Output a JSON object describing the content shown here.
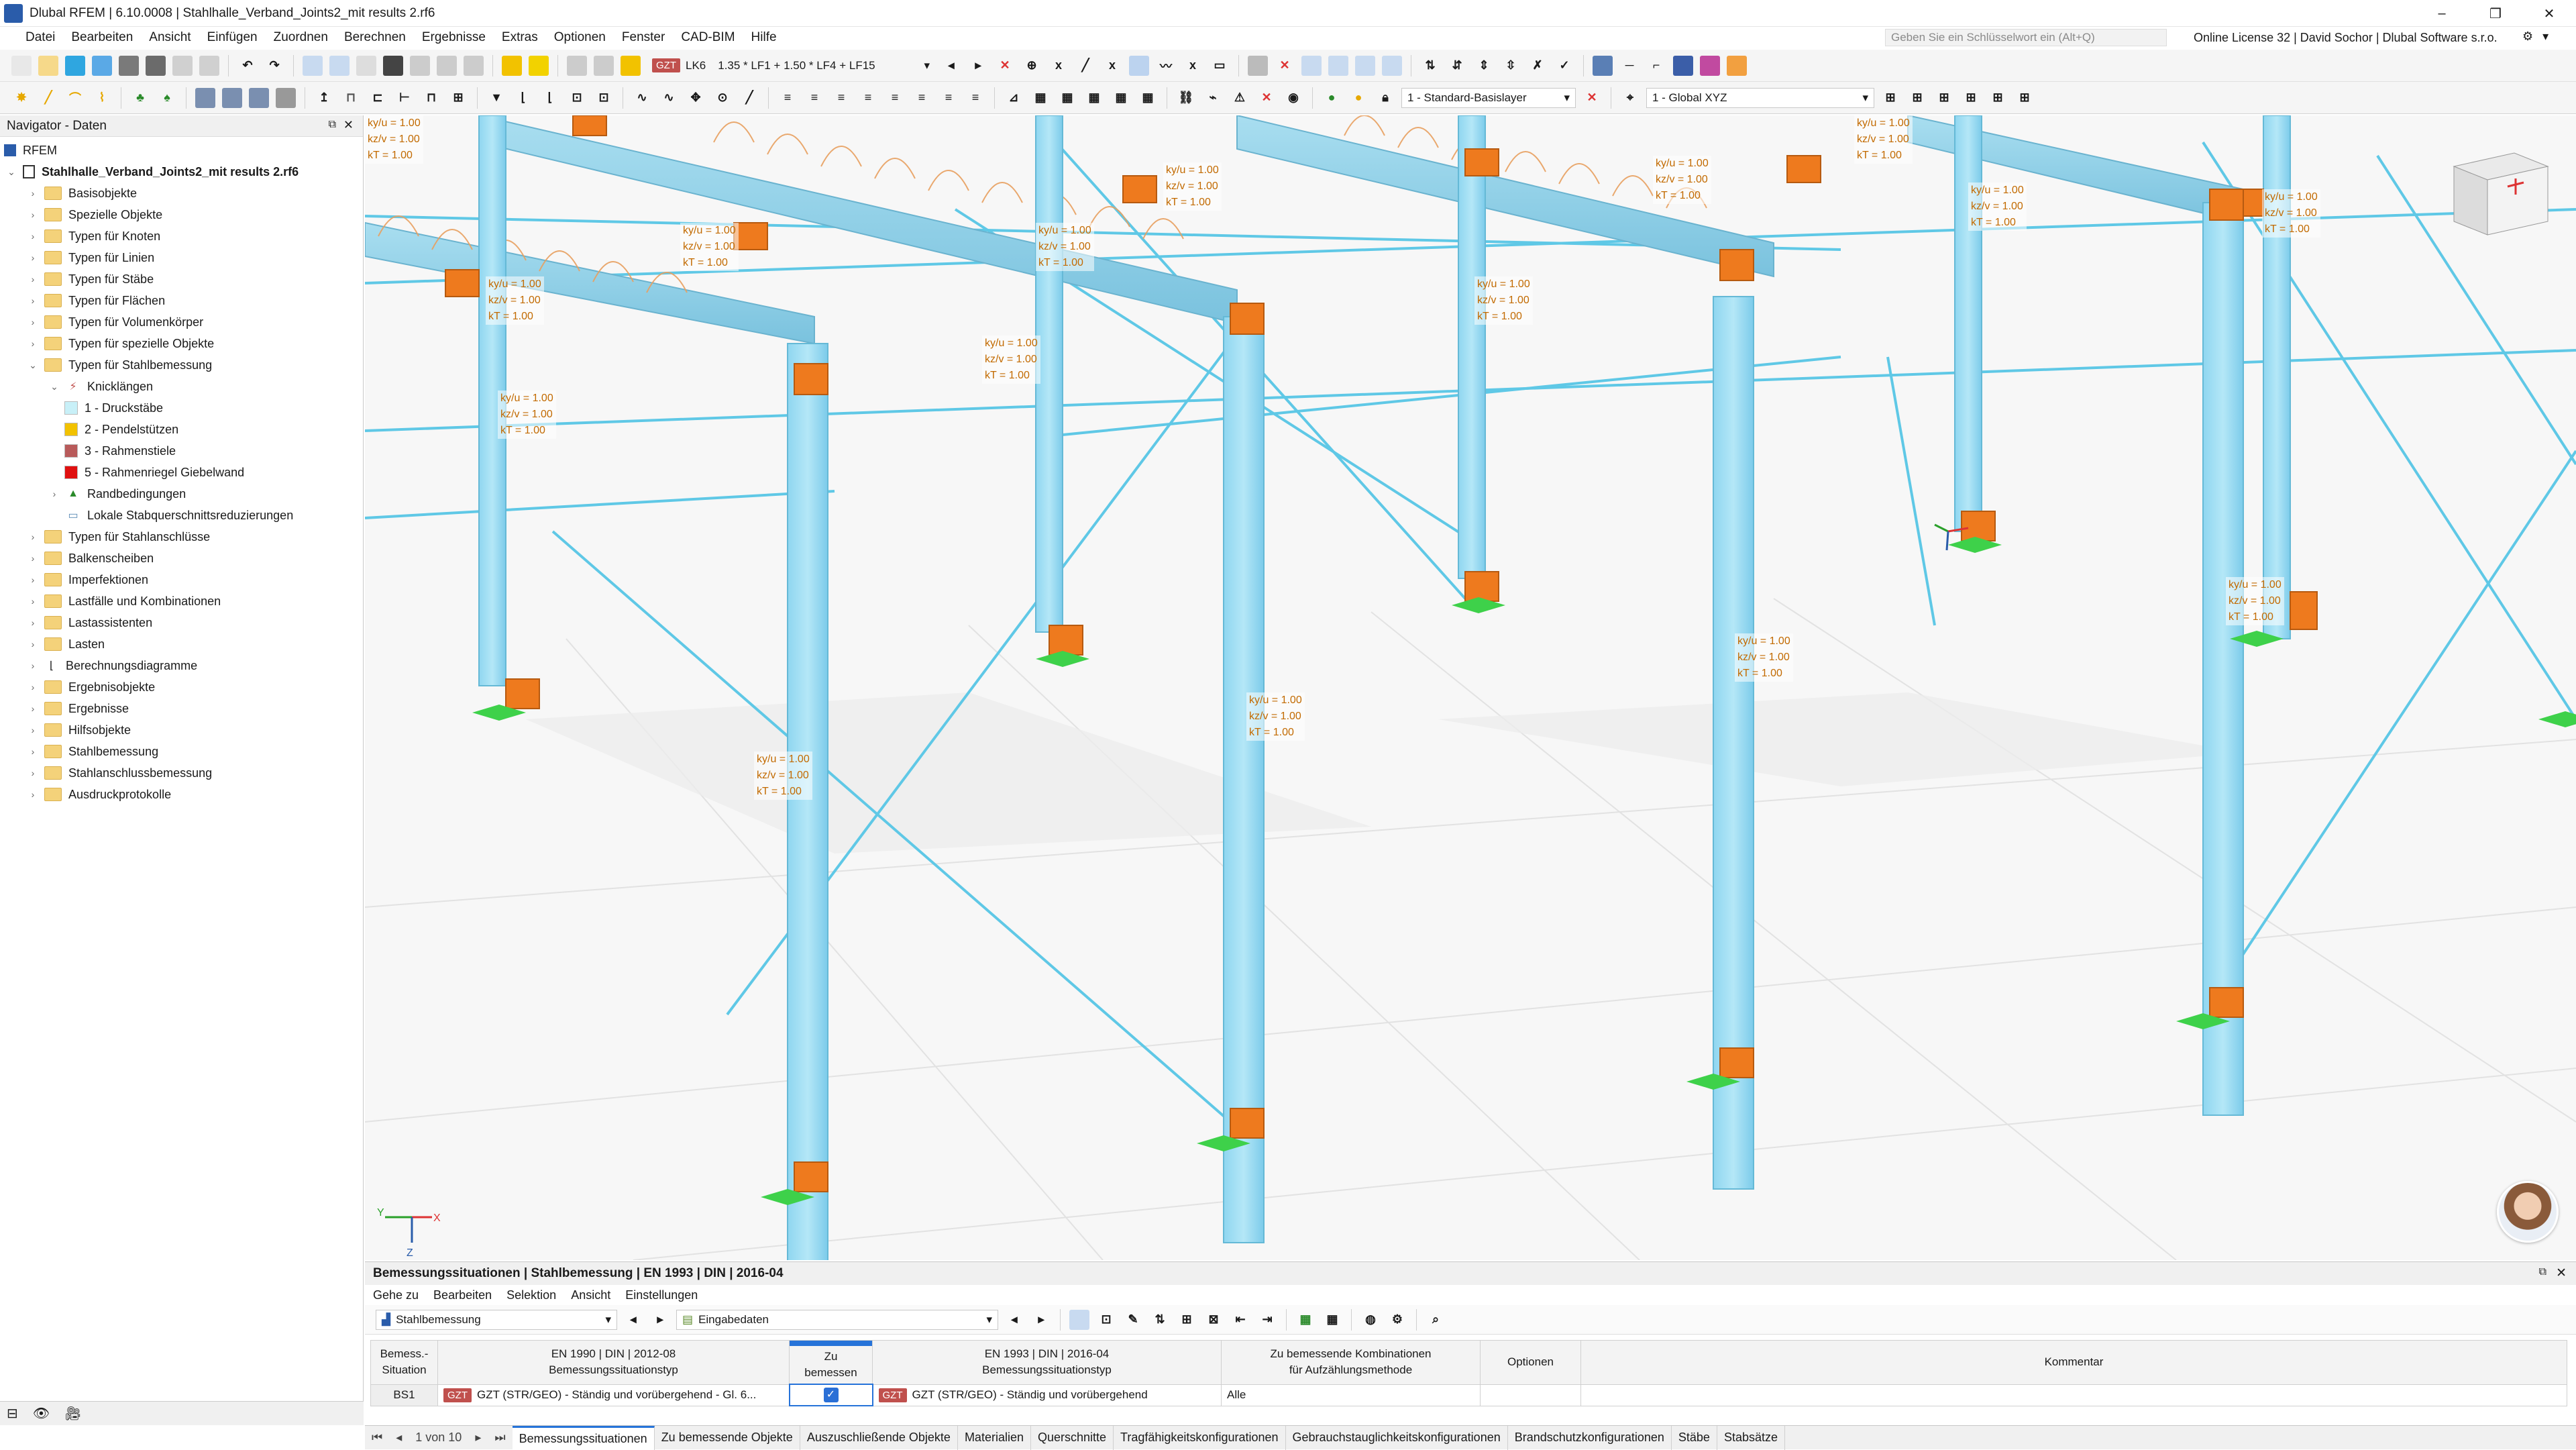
{
  "window": {
    "title": "Dlubal RFEM | 6.10.0008 | Stahlhalle_Verband_Joints2_mit results 2.rf6",
    "minimize": "–",
    "restore": "❐",
    "close": "✕"
  },
  "menu": [
    "Datei",
    "Bearbeiten",
    "Ansicht",
    "Einfügen",
    "Zuordnen",
    "Berechnen",
    "Ergebnisse",
    "Extras",
    "Optionen",
    "Fenster",
    "CAD-BIM",
    "Hilfe"
  ],
  "search": {
    "placeholder": "Geben Sie ein Schlüsselwort ein (Alt+Q)"
  },
  "license": "Online License 32 | David Sochor | Dlubal Software s.r.o.",
  "toolbar": {
    "load_badge": "GZT",
    "load_case": "LK6",
    "combination": "1.35 * LF1 + 1.50 * LF4 + LF15",
    "layer": "1 - Standard-Basislayer",
    "coord_system": "1 - Global XYZ"
  },
  "navigator": {
    "title": "Navigator - Daten",
    "root": "RFEM",
    "file": "Stahlhalle_Verband_Joints2_mit results 2.rf6",
    "items": [
      {
        "label": "Basisobjekte",
        "level": 1,
        "type": "folder"
      },
      {
        "label": "Spezielle Objekte",
        "level": 1,
        "type": "folder"
      },
      {
        "label": "Typen für Knoten",
        "level": 1,
        "type": "folder"
      },
      {
        "label": "Typen für Linien",
        "level": 1,
        "type": "folder"
      },
      {
        "label": "Typen für Stäbe",
        "level": 1,
        "type": "folder"
      },
      {
        "label": "Typen für Flächen",
        "level": 1,
        "type": "folder"
      },
      {
        "label": "Typen für Volumenkörper",
        "level": 1,
        "type": "folder"
      },
      {
        "label": "Typen für spezielle Objekte",
        "level": 1,
        "type": "folder"
      },
      {
        "label": "Typen für Stahlbemessung",
        "level": 1,
        "type": "folder",
        "expanded": true
      },
      {
        "label": "Knicklängen",
        "level": 2,
        "type": "knick",
        "expanded": true
      },
      {
        "label": "1 - Druckstäbe",
        "level": 3,
        "type": "color",
        "color": "#c8f0f8"
      },
      {
        "label": "2 - Pendelstützen",
        "level": 3,
        "type": "color",
        "color": "#f2c200"
      },
      {
        "label": "3 - Rahmenstiele",
        "level": 3,
        "type": "color",
        "color": "#b85a5a"
      },
      {
        "label": "5 - Rahmenriegel Giebelwand",
        "level": 3,
        "type": "color",
        "color": "#e01010"
      },
      {
        "label": "Randbedingungen",
        "level": 2,
        "type": "rand"
      },
      {
        "label": "Lokale Stabquerschnittsreduzierungen",
        "level": 2,
        "type": "lokal"
      },
      {
        "label": "Typen für Stahlanschlüsse",
        "level": 1,
        "type": "folder"
      },
      {
        "label": "Balkenscheiben",
        "level": 1,
        "type": "folder"
      },
      {
        "label": "Imperfektionen",
        "level": 1,
        "type": "folder"
      },
      {
        "label": "Lastfälle und Kombinationen",
        "level": 1,
        "type": "folder"
      },
      {
        "label": "Lastassistenten",
        "level": 1,
        "type": "folder"
      },
      {
        "label": "Lasten",
        "level": 1,
        "type": "folder"
      },
      {
        "label": "Berechnungsdiagramme",
        "level": 1,
        "type": "diagram"
      },
      {
        "label": "Ergebnisobjekte",
        "level": 1,
        "type": "folder"
      },
      {
        "label": "Ergebnisse",
        "level": 1,
        "type": "folder"
      },
      {
        "label": "Hilfsobjekte",
        "level": 1,
        "type": "folder"
      },
      {
        "label": "Stahlbemessung",
        "level": 1,
        "type": "folder"
      },
      {
        "label": "Stahlanschlussbemessung",
        "level": 1,
        "type": "folder"
      },
      {
        "label": "Ausdruckprotokolle",
        "level": 1,
        "type": "folder"
      }
    ]
  },
  "viewport": {
    "klabel_lines": [
      "ky/u = 1.00",
      "kz/v = 1.00",
      "kT = 1.00"
    ],
    "axis": {
      "y": "Y",
      "x": "X",
      "z": "Z"
    }
  },
  "bottom_panel": {
    "title": "Bemessungssituationen | Stahlbemessung | EN 1993 | DIN | 2016-04",
    "menu": [
      "Gehe zu",
      "Bearbeiten",
      "Selektion",
      "Ansicht",
      "Einstellungen"
    ],
    "module_combo": "Stahlbemessung",
    "data_combo": "Eingabedaten",
    "columns": [
      "Bemess.-\nSituation",
      "EN 1990 | DIN | 2012-08\nBemessungssituationstyp",
      "Zu\nbemessen",
      "EN 1993 | DIN | 2016-04\nBemessungssituationstyp",
      "Zu bemessende Kombinationen\nfür Aufzählungsmethode",
      "Optionen",
      "Kommentar"
    ],
    "row": {
      "id": "BS1",
      "badge1": "GZT",
      "type1": "GZT (STR/GEO) - Ständig und vorübergehend - Gl. 6...",
      "check": "✓",
      "badge2": "GZT",
      "type2": "GZT (STR/GEO) - Ständig und vorübergehend",
      "combos": "Alle",
      "options": "",
      "comment": ""
    }
  },
  "tabs": {
    "pager": "1 von 10",
    "items": [
      "Bemessungssituationen",
      "Zu bemessende Objekte",
      "Auszuschließende Objekte",
      "Materialien",
      "Querschnitte",
      "Tragfähigkeitskonfigurationen",
      "Gebrauchstauglichkeitskonfigurationen",
      "Brandschutzkonfigurationen",
      "Stäbe",
      "Stabsätze"
    ],
    "active": 0
  }
}
